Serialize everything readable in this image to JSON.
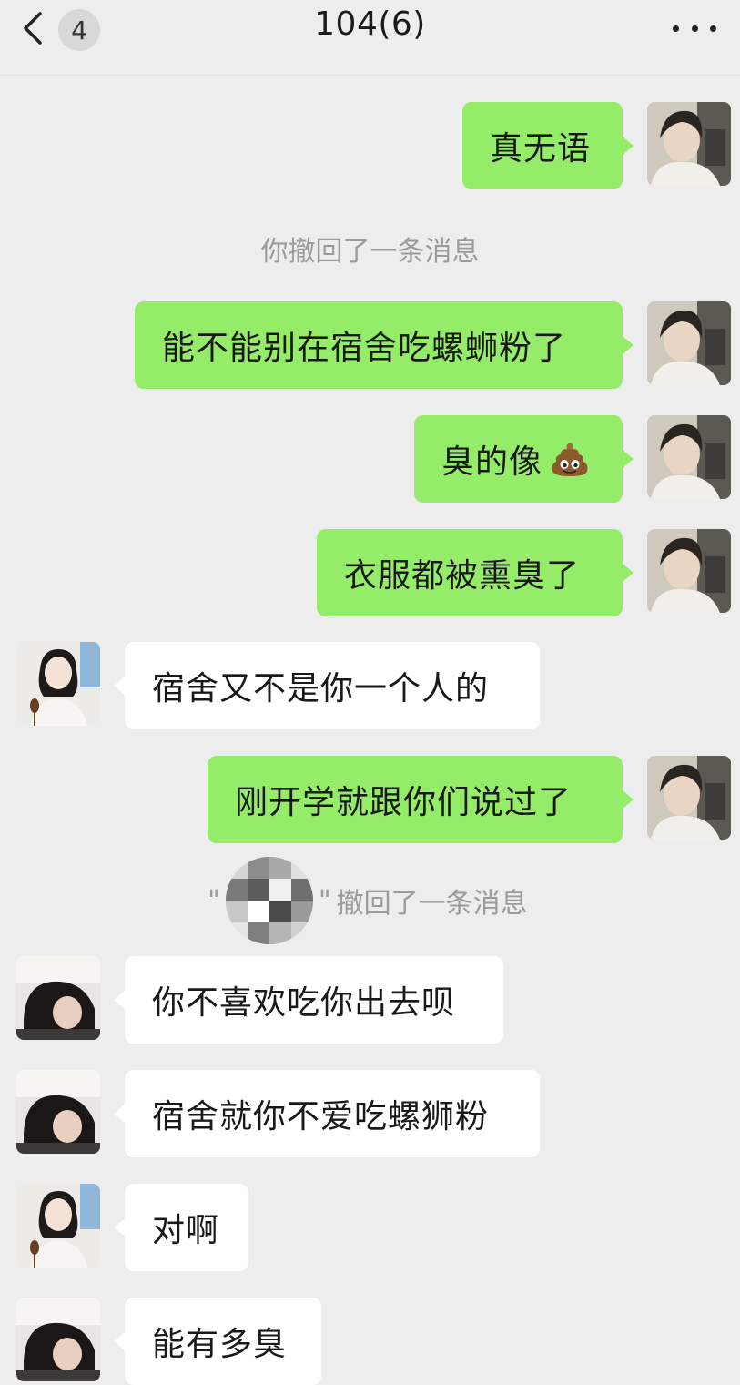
{
  "header": {
    "unread_count": "4",
    "title": "104(6)"
  },
  "messages": [
    {
      "side": "self",
      "text": "真无语"
    },
    {
      "system": "你撤回了一条消息"
    },
    {
      "side": "self",
      "text": "能不能别在宿舍吃螺蛳粉了"
    },
    {
      "side": "self",
      "text": "臭的像",
      "emoji": "poop-icon"
    },
    {
      "side": "self",
      "text": "衣服都被熏臭了"
    },
    {
      "side": "other",
      "text": "宿舍又不是你一个人的"
    },
    {
      "side": "self",
      "text": "刚开学就跟你们说过了"
    },
    {
      "system_open_quote": "\"",
      "system_close_quote": "\"",
      "system_suffix": "撤回了一条消息"
    },
    {
      "side": "other",
      "text": "你不喜欢吃你出去呗"
    },
    {
      "side": "other",
      "text": "宿舍就你不爱吃螺狮粉"
    },
    {
      "side": "other",
      "text": "对啊"
    },
    {
      "side": "other",
      "text": "能有多臭"
    }
  ],
  "colors": {
    "background": "#ededed",
    "self_bubble": "#95ec69",
    "other_bubble": "#ffffff",
    "system_text": "#9b9b9b"
  }
}
